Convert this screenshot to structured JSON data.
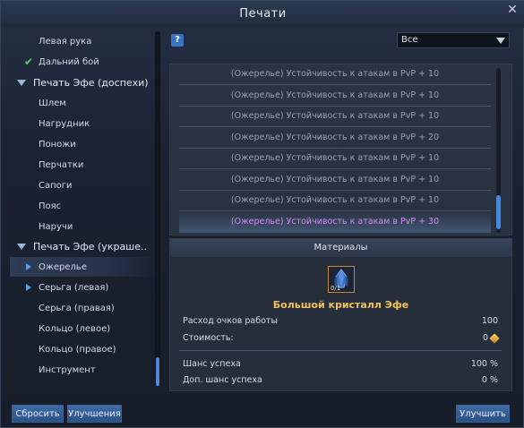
{
  "window": {
    "title": "Печати",
    "close_glyph": "✕"
  },
  "tree": {
    "items": [
      {
        "label": "Левая рука",
        "kind": "leaf"
      },
      {
        "label": "Дальний бой",
        "kind": "checked"
      },
      {
        "label": "Печать Эфе (доспехи)",
        "kind": "group"
      },
      {
        "label": "Шлем",
        "kind": "leaf"
      },
      {
        "label": "Нагрудник",
        "kind": "leaf"
      },
      {
        "label": "Поножи",
        "kind": "leaf"
      },
      {
        "label": "Перчатки",
        "kind": "leaf"
      },
      {
        "label": "Сапоги",
        "kind": "leaf"
      },
      {
        "label": "Пояс",
        "kind": "leaf"
      },
      {
        "label": "Наручи",
        "kind": "leaf"
      },
      {
        "label": "Печать Эфе (украше..",
        "kind": "group"
      },
      {
        "label": "Ожерелье",
        "kind": "selected"
      },
      {
        "label": "Серьга (левая)",
        "kind": "arrow"
      },
      {
        "label": "Серьга (правая)",
        "kind": "leaf"
      },
      {
        "label": "Кольцо (левое)",
        "kind": "leaf"
      },
      {
        "label": "Кольцо (правое)",
        "kind": "leaf"
      },
      {
        "label": "Инструмент",
        "kind": "leaf"
      }
    ]
  },
  "filter": {
    "help_glyph": "?",
    "selected": "Все"
  },
  "effects": {
    "rows": [
      "(Ожерелье) Устойчивость к атакам в PvP + 10",
      "(Ожерелье) Устойчивость к атакам в PvP + 10",
      "(Ожерелье) Устойчивость к атакам в PvP + 10",
      "(Ожерелье) Устойчивость к атакам в PvP + 20",
      "(Ожерелье) Устойчивость к атакам в PvP + 10",
      "(Ожерелье) Устойчивость к атакам в PvP + 10",
      "(Ожерелье) Устойчивость к атакам в PvP + 10",
      "(Ожерелье) Устойчивость к атакам в PvP + 30"
    ],
    "highlight_color": "#d38ef2"
  },
  "materials": {
    "header": "Материалы",
    "item_name": "Большой кристалл Эфе",
    "item_count": "0/1",
    "work_points_label": "Расход очков работы",
    "work_points_value": "100",
    "cost_label": "Стоимость:",
    "cost_value": "0",
    "success_label": "Шанс успеха",
    "success_value": "100 %",
    "extra_success_label": "Доп. шанс успеха",
    "extra_success_value": "0 %"
  },
  "buttons": {
    "reset": "Сбросить",
    "upgrades": "Улучшения",
    "improve": "Улучшить"
  },
  "colors": {
    "accent": "#4d88d6",
    "gold": "#f2c25a",
    "check": "#5fcf5f"
  }
}
